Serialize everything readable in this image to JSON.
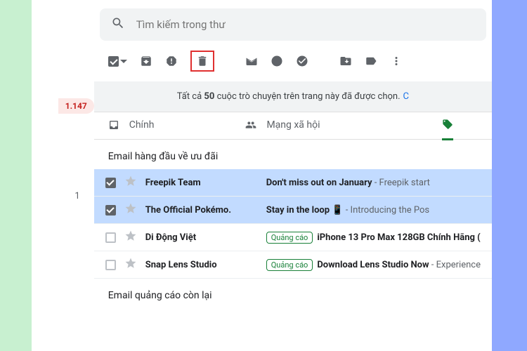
{
  "search": {
    "placeholder": "Tìm kiếm trong thư"
  },
  "sidebar": {
    "unread_count": "1.147",
    "item_count": "1"
  },
  "banner": {
    "prefix": "Tất cả ",
    "count": "50",
    "suffix": " cuộc trò chuyện trên trang này đã được chọn.",
    "link_fragment": "C"
  },
  "tabs": {
    "primary": "Chính",
    "social": "Mạng xã hội"
  },
  "sections": {
    "top_deals": "Email hàng đầu về ưu đãi",
    "remaining_ads": "Email quảng cáo còn lại"
  },
  "ad_label": "Quảng cáo",
  "rows": [
    {
      "sender": "Freepik Team",
      "subject": "Don't miss out on January",
      "snippet": " - Freepik start"
    },
    {
      "sender": "The Official Pokémo.",
      "subject": "Stay in the loop ",
      "snippet": " - Introducing the Pos"
    },
    {
      "sender": "Di Động Việt",
      "subject": "iPhone 13 Pro Max 128GB Chính Hãng (",
      "snippet": ""
    },
    {
      "sender": "Snap Lens Studio",
      "subject": "Download Lens Studio Now",
      "snippet": " - Experience"
    }
  ]
}
